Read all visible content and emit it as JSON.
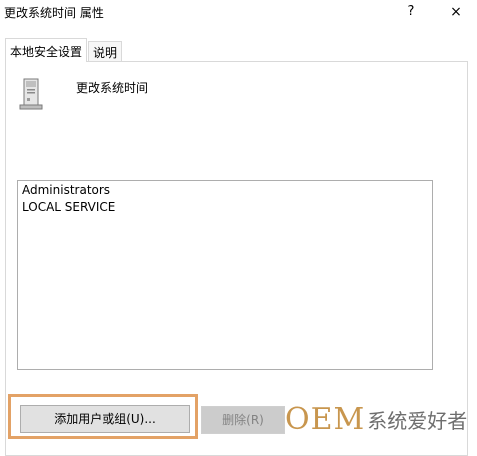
{
  "window": {
    "title": "更改系统时间 属性",
    "help_label": "?",
    "close_label": "×"
  },
  "tabs": [
    {
      "label": "本地安全设置",
      "active": true
    },
    {
      "label": "说明",
      "active": false
    }
  ],
  "policy": {
    "icon": "computer-tower-icon",
    "name": "更改系统时间"
  },
  "members": [
    "Administrators",
    "LOCAL SERVICE"
  ],
  "buttons": {
    "add_label": "添加用户或组(U)...",
    "remove_label": "删除(R)"
  },
  "watermark": {
    "brand": "OEM",
    "text": "系统爱好者"
  },
  "colors": {
    "highlight_border": "#e3a266",
    "watermark_brand": "#c8964e"
  }
}
